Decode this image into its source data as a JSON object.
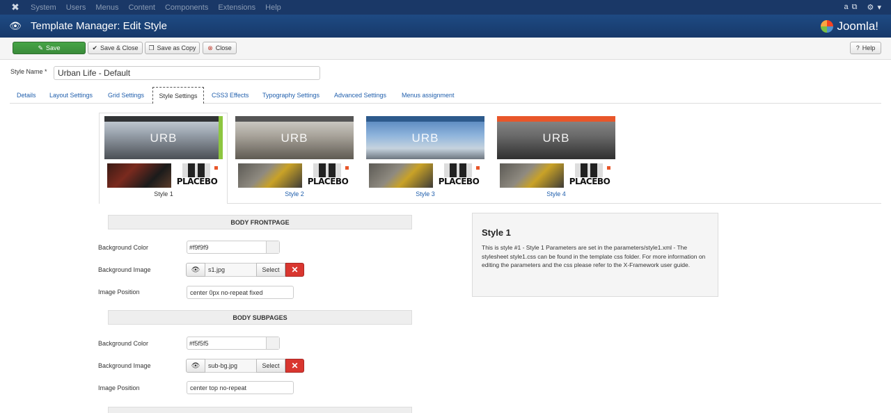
{
  "topbar": {
    "menu": [
      "System",
      "Users",
      "Menus",
      "Content",
      "Components",
      "Extensions",
      "Help"
    ],
    "user": "a",
    "settings_caret": "▾"
  },
  "header": {
    "title": "Template Manager: Edit Style",
    "brand": "Joomla!"
  },
  "toolbar": {
    "save": "Save",
    "save_close": "Save & Close",
    "save_copy": "Save as Copy",
    "close": "Close",
    "help": "Help"
  },
  "form": {
    "style_name_label": "Style Name *",
    "style_name_value": "Urban Life - Default"
  },
  "tabs": [
    {
      "label": "Details",
      "active": false
    },
    {
      "label": "Layout Settings",
      "active": false
    },
    {
      "label": "Grid Settings",
      "active": false
    },
    {
      "label": "Style Settings",
      "active": true
    },
    {
      "label": "CSS3 Effects",
      "active": false
    },
    {
      "label": "Typography Settings",
      "active": false
    },
    {
      "label": "Advanced Settings",
      "active": false
    },
    {
      "label": "Menus assignment",
      "active": false
    }
  ],
  "styles": [
    {
      "label": "Style 1",
      "active": true,
      "logo_text": "URB",
      "placebo_text": "PLACEBO",
      "accent": "#8dc63f"
    },
    {
      "label": "Style 2",
      "active": false,
      "logo_text": "URB",
      "placebo_text": "PLACEBO",
      "accent": "#555555"
    },
    {
      "label": "Style 3",
      "active": false,
      "logo_text": "URB",
      "placebo_text": "PLACEBO",
      "accent": "#3b6ea5"
    },
    {
      "label": "Style 4",
      "active": false,
      "logo_text": "URB",
      "placebo_text": "PLACEBO",
      "accent": "#e8562a"
    }
  ],
  "sections": [
    {
      "title": "BODY FRONTPAGE",
      "bg_color_label": "Background Color",
      "bg_color": "#f9f9f9",
      "bg_image_label": "Background Image",
      "bg_image": "s1.jpg",
      "select_label": "Select",
      "image_position_label": "Image Position",
      "image_position": "center 0px no-repeat fixed"
    },
    {
      "title": "BODY SUBPAGES",
      "bg_color_label": "Background Color",
      "bg_color": "#f5f5f5",
      "bg_image_label": "Background Image",
      "bg_image": "sub-bg.jpg",
      "select_label": "Select",
      "image_position_label": "Image Position",
      "image_position": "center top no-repeat"
    }
  ],
  "info": {
    "title": "Style 1",
    "description": "This is style #1 - Style 1 Parameters are set in the parameters/style1.xml - The stylesheet style1.css can be found in the template css folder. For more information on editing the parameters and the css please refer to the X-Framework user guide."
  },
  "colors": {
    "topbar": "#1a3867",
    "header": "#1e4a83",
    "save_green": "#46a546",
    "remove_red": "#d9362f",
    "link_blue": "#1f5eac"
  }
}
